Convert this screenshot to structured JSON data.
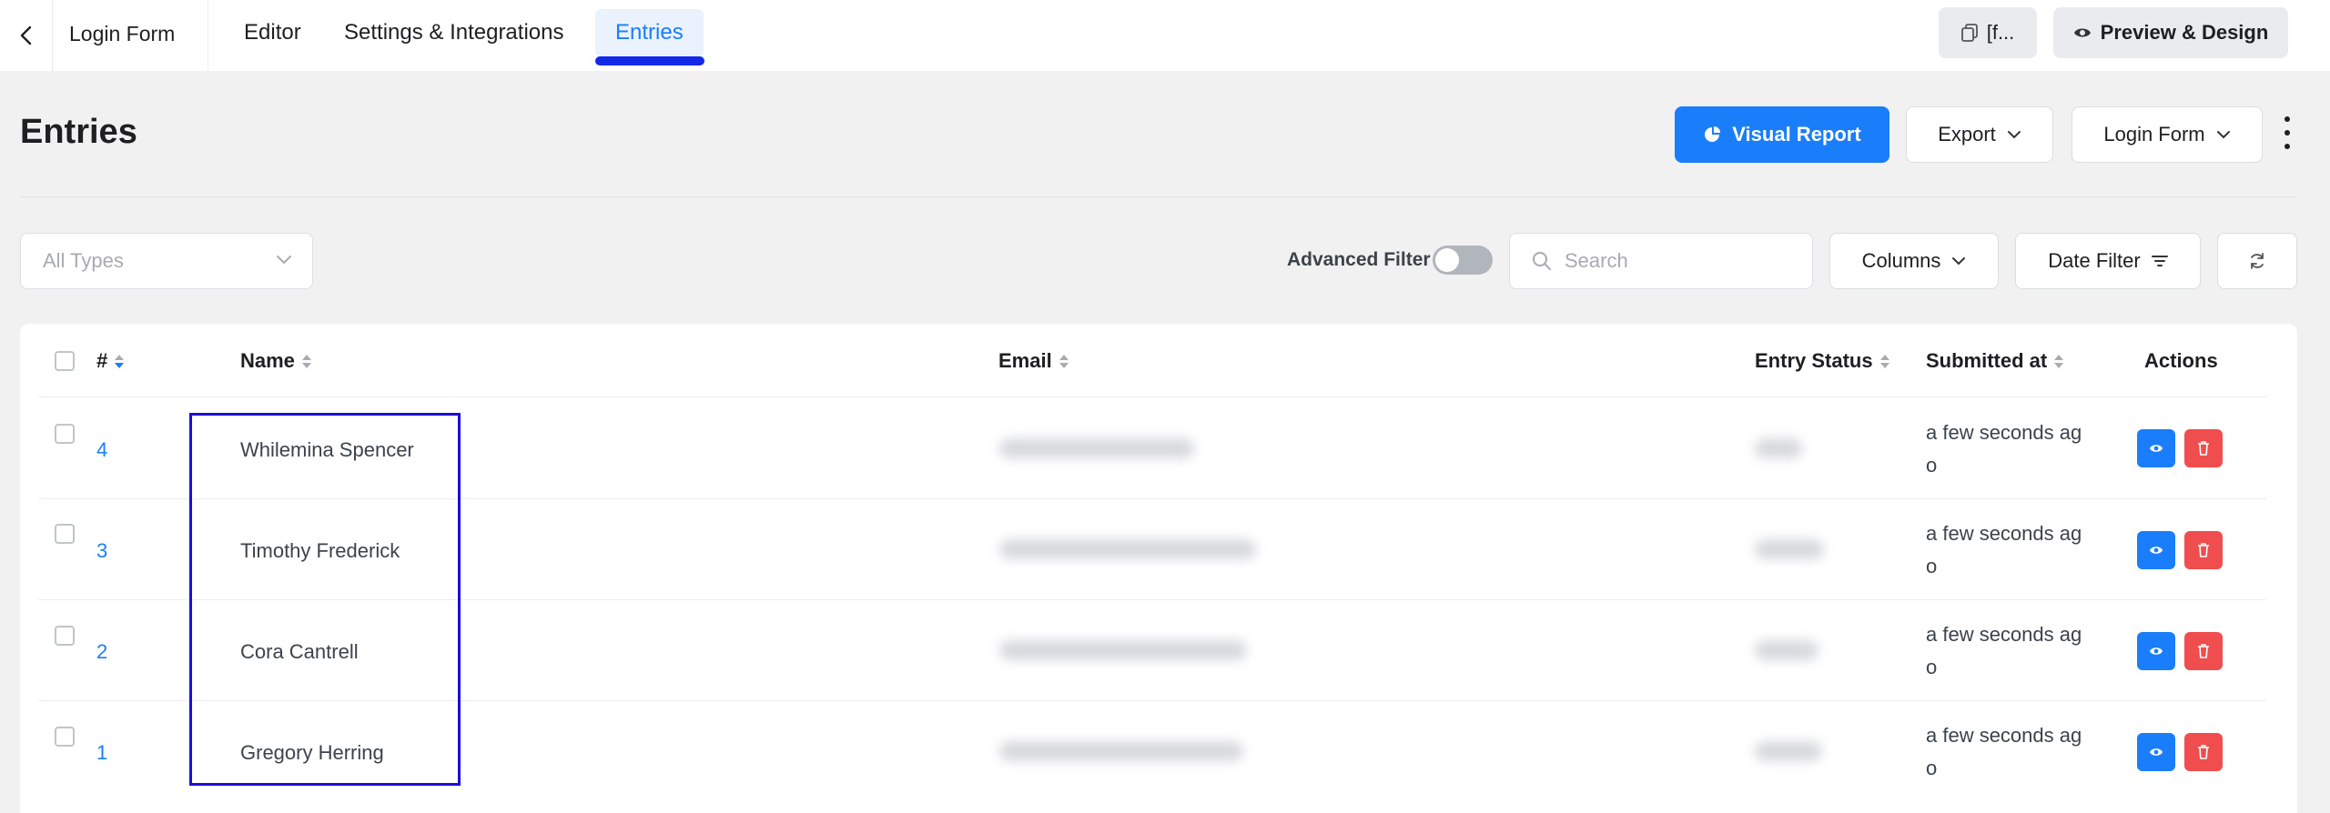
{
  "topbar": {
    "form_title": "Login Form",
    "tabs": [
      {
        "label": "Editor",
        "active": false
      },
      {
        "label": "Settings & Integrations",
        "active": false
      },
      {
        "label": "Entries",
        "active": true
      }
    ],
    "shortcode_label": "[f...",
    "preview_label": "Preview & Design",
    "accent_color": "#1a7efb",
    "active_underline_color": "#1428e8"
  },
  "header": {
    "title": "Entries",
    "visual_report_label": "Visual Report",
    "export_label": "Export",
    "form_select_label": "Login Form"
  },
  "filters": {
    "type_placeholder": "All Types",
    "advanced_filter_label": "Advanced Filter",
    "advanced_filter_on": false,
    "search_placeholder": "Search",
    "columns_label": "Columns",
    "date_filter_label": "Date Filter"
  },
  "table": {
    "columns": {
      "id": "#",
      "name": "Name",
      "email": "Email",
      "status": "Entry Status",
      "submitted": "Submitted at",
      "actions": "Actions"
    },
    "rows": [
      {
        "id": "4",
        "name": "Whilemina Spencer",
        "submitted_line1": "a few seconds ag",
        "submitted_line2": "o"
      },
      {
        "id": "3",
        "name": "Timothy Frederick",
        "submitted_line1": "a few seconds ag",
        "submitted_line2": "o"
      },
      {
        "id": "2",
        "name": "Cora Cantrell",
        "submitted_line1": "a few seconds ag",
        "submitted_line2": "o"
      },
      {
        "id": "1",
        "name": "Gregory Herring",
        "submitted_line1": "a few seconds ag",
        "submitted_line2": "o"
      }
    ]
  },
  "icons": [
    "chevron-left-icon",
    "copy-icon",
    "eye-icon",
    "pie-chart-icon",
    "chevron-down-icon",
    "search-icon",
    "filter-lines-icon",
    "refresh-icon",
    "kebab-icon",
    "trash-icon",
    "sort-icon"
  ]
}
